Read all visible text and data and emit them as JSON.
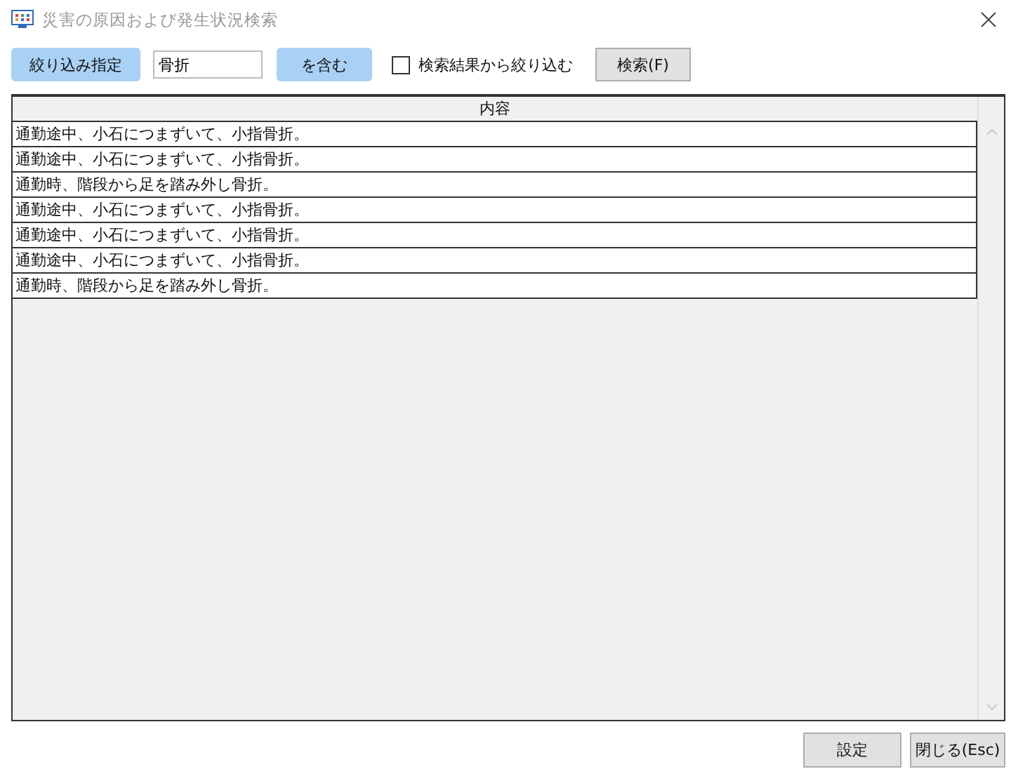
{
  "window": {
    "title": "災害の原因および発生状況検索"
  },
  "toolbar": {
    "filter_button": "絞り込み指定",
    "search_field": {
      "value": "骨折"
    },
    "condition_button": "を含む",
    "refine_checkbox": {
      "label": "検索結果から絞り込む",
      "checked": false
    },
    "search_button": "検索(F)"
  },
  "table": {
    "columns": [
      "内容"
    ],
    "rows": [
      {
        "text": "通勤途中、小石につまずいて、小指骨折。"
      },
      {
        "text": "通勤途中、小石につまずいて、小指骨折。"
      },
      {
        "text": "通勤時、階段から足を踏み外し骨折。"
      },
      {
        "text": "通勤途中、小石につまずいて、小指骨折。"
      },
      {
        "text": "通勤途中、小石につまずいて、小指骨折。"
      },
      {
        "text": "通勤途中、小石につまずいて、小指骨折。"
      },
      {
        "text": "通勤時、階段から足を踏み外し骨折。"
      }
    ]
  },
  "buttons": [
    "設定",
    "閉じる(Esc)"
  ]
}
